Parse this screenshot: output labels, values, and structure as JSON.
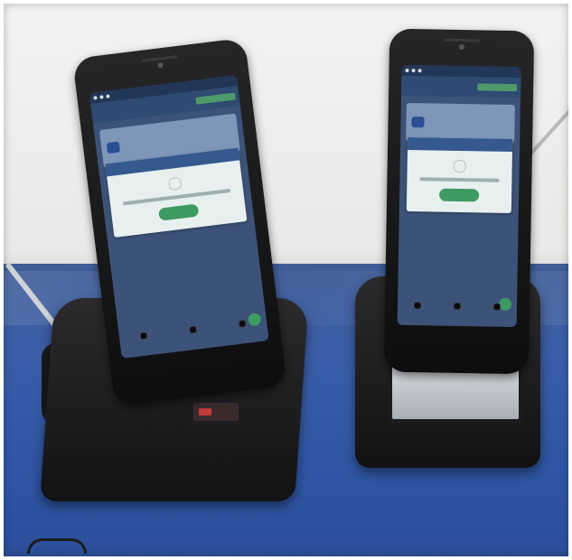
{
  "scene": {
    "background_wall": "#eeeeec",
    "table_color": "#3a5ea8"
  },
  "phones": [
    {
      "name": "left",
      "screen": {
        "dialog": {
          "title": "",
          "ok_label": ""
        },
        "accent_color": "#3d9a62"
      }
    },
    {
      "name": "right",
      "screen": {
        "dialog": {
          "title": "",
          "ok_label": ""
        },
        "accent_color": "#3d9a62"
      }
    }
  ]
}
